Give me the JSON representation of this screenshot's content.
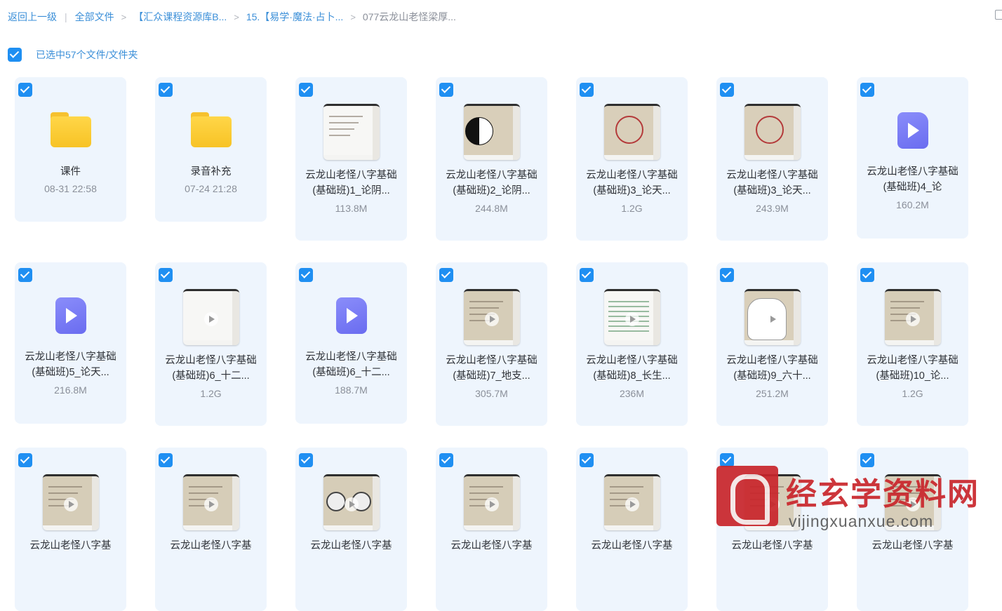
{
  "breadcrumb": {
    "back": "返回上一级",
    "all_files": "全部文件",
    "level1": "【汇众课程资源库B...",
    "level2": "15.【易学·魔法·占卜...",
    "current": "077云龙山老怪梁厚..."
  },
  "selection": {
    "label": "已选中57个文件/文件夹"
  },
  "files": [
    {
      "type": "folder",
      "name": "课件",
      "meta": "08-31 22:58"
    },
    {
      "type": "folder",
      "name": "录音补充",
      "meta": "07-24 21:28"
    },
    {
      "type": "video-thumb",
      "name": "云龙山老怪八字基础(基础班)1_论阴...",
      "meta": "113.8M"
    },
    {
      "type": "video-thumb",
      "name": "云龙山老怪八字基础(基础班)2_论阴...",
      "meta": "244.8M"
    },
    {
      "type": "video-thumb",
      "name": "云龙山老怪八字基础(基础班)3_论天...",
      "meta": "1.2G"
    },
    {
      "type": "video-thumb",
      "name": "云龙山老怪八字基础(基础班)3_论天...",
      "meta": "243.9M"
    },
    {
      "type": "video-icon",
      "name": "云龙山老怪八字基础(基础班)4_论",
      "meta": "160.2M"
    },
    {
      "type": "video-icon",
      "name": "云龙山老怪八字基础(基础班)5_论天...",
      "meta": "216.8M"
    },
    {
      "type": "video-thumb",
      "name": "云龙山老怪八字基础(基础班)6_十二...",
      "meta": "1.2G"
    },
    {
      "type": "video-icon",
      "name": "云龙山老怪八字基础(基础班)6_十二...",
      "meta": "188.7M"
    },
    {
      "type": "video-thumb",
      "name": "云龙山老怪八字基础(基础班)7_地支...",
      "meta": "305.7M"
    },
    {
      "type": "video-thumb",
      "name": "云龙山老怪八字基础(基础班)8_长生...",
      "meta": "236M"
    },
    {
      "type": "video-thumb",
      "name": "云龙山老怪八字基础(基础班)9_六十...",
      "meta": "251.2M"
    },
    {
      "type": "video-thumb",
      "name": "云龙山老怪八字基础(基础班)10_论...",
      "meta": "1.2G"
    },
    {
      "type": "video-thumb",
      "name": "云龙山老怪八字基",
      "meta": ""
    },
    {
      "type": "video-thumb",
      "name": "云龙山老怪八字基",
      "meta": ""
    },
    {
      "type": "video-thumb",
      "name": "云龙山老怪八字基",
      "meta": ""
    },
    {
      "type": "video-thumb",
      "name": "云龙山老怪八字基",
      "meta": ""
    },
    {
      "type": "video-thumb",
      "name": "云龙山老怪八字基",
      "meta": ""
    },
    {
      "type": "video-thumb",
      "name": "云龙山老怪八字基",
      "meta": ""
    },
    {
      "type": "video-thumb",
      "name": "云龙山老怪八字基",
      "meta": ""
    }
  ],
  "watermark": {
    "title": "经玄学资料网",
    "url": "vijingxuanxue.com"
  },
  "colors": {
    "accent": "#1f8ff2",
    "card_bg": "#eef5fd",
    "link": "#3b8fd8",
    "video_icon": "#7b7df5",
    "watermark": "#c9252b"
  }
}
